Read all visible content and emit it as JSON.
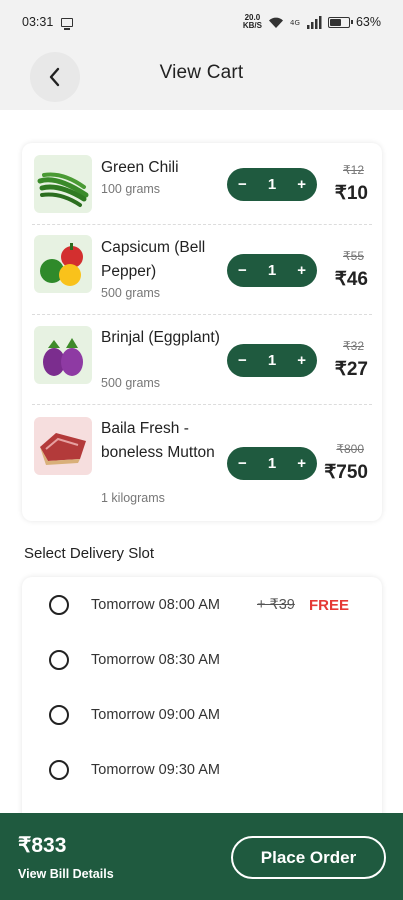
{
  "status_bar": {
    "time": "03:31",
    "net_speed_top": "20.0",
    "net_speed_bottom": "KB/S",
    "battery": "63%"
  },
  "header": {
    "title": "View Cart",
    "back_icon": "chevron-left-icon"
  },
  "cart": {
    "items": [
      {
        "name": "Green Chili",
        "quantity": "100 grams",
        "count": "1",
        "old_price": "₹12",
        "price": "₹10",
        "image": "green-chili-image"
      },
      {
        "name": "Capsicum (Bell Pepper)",
        "quantity": "500 grams",
        "count": "1",
        "old_price": "₹55",
        "price": "₹46",
        "image": "capsicum-image"
      },
      {
        "name": "Brinjal (Eggplant)",
        "quantity": "500 grams",
        "count": "1",
        "old_price": "₹32",
        "price": "₹27",
        "image": "brinjal-image"
      },
      {
        "name": "Baila Fresh - boneless Mutton",
        "quantity": "1 kilograms",
        "count": "1",
        "old_price": "₹800",
        "price": "₹750",
        "image": "mutton-image"
      }
    ],
    "minus_symbol": "−",
    "plus_symbol": "+"
  },
  "delivery": {
    "title": "Select Delivery Slot",
    "slots": [
      {
        "label": "Tomorrow 08:00 AM",
        "fee": "+ ₹39",
        "free": "FREE"
      },
      {
        "label": "Tomorrow 08:30 AM"
      },
      {
        "label": "Tomorrow 09:00 AM"
      },
      {
        "label": "Tomorrow 09:30 AM"
      }
    ]
  },
  "footer": {
    "total": "₹833",
    "bill_link": "View Bill Details",
    "place_order": "Place Order"
  },
  "colors": {
    "primary": "#1f5a3f",
    "free_red": "#e53935"
  }
}
